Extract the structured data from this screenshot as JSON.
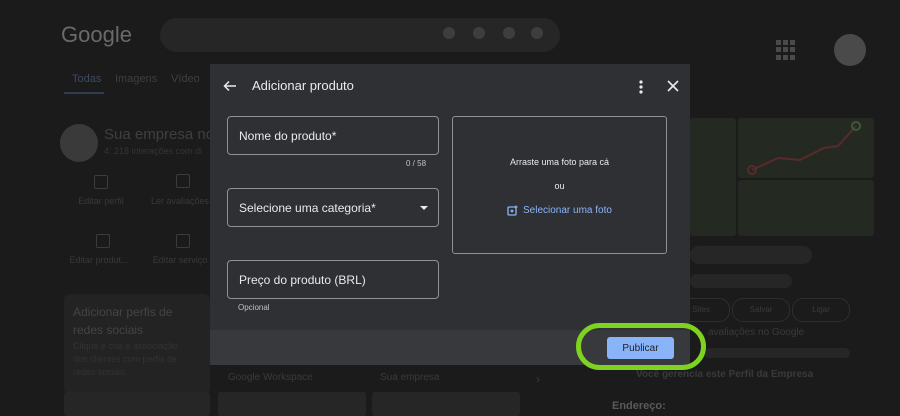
{
  "background": {
    "logo": "Google",
    "tabs": [
      "Todas",
      "Imagens",
      "Vídeo"
    ],
    "business": {
      "name": "Sua empresa no",
      "sub": "4: 218 interações com di"
    },
    "actions": [
      {
        "label": "Editar perfil",
        "icon": "storefront-icon"
      },
      {
        "label": "Ler avaliações",
        "icon": "reviews-icon"
      },
      {
        "label": "Editar produt...",
        "icon": "bag-icon"
      },
      {
        "label": "Editar serviço",
        "icon": "list-icon"
      }
    ],
    "card": {
      "title": "Adicionar perfis de redes sociais",
      "body": "Clique e crie e associação dos clientes com perfis de redes sociais"
    },
    "bottom_labels": [
      "Google Workspace",
      "Sua empresa"
    ],
    "right": {
      "buttons": [
        "Sites",
        "Salvar",
        "Ligar"
      ],
      "reviews_text": "avaliações no Google",
      "managed_text": "Você gerencia este Perfil da Empresa",
      "address_label": "Endereço:"
    }
  },
  "dialog": {
    "title": "Adicionar produto",
    "fields": {
      "name": {
        "label": "Nome do produto*",
        "counter": "0 / 58"
      },
      "category": {
        "label": "Selecione uma categoria*"
      },
      "price": {
        "label": "Preço do produto (BRL)",
        "helper": "Opcional"
      }
    },
    "photo": {
      "drag_text": "Arraste uma foto para cá",
      "or_text": "ou",
      "select_link": "Selecionar uma foto"
    },
    "publish_label": "Publicar"
  },
  "colors": {
    "accent": "#8ab4f8",
    "dialog_bg": "#2f3033",
    "highlight": "#7ed321"
  }
}
